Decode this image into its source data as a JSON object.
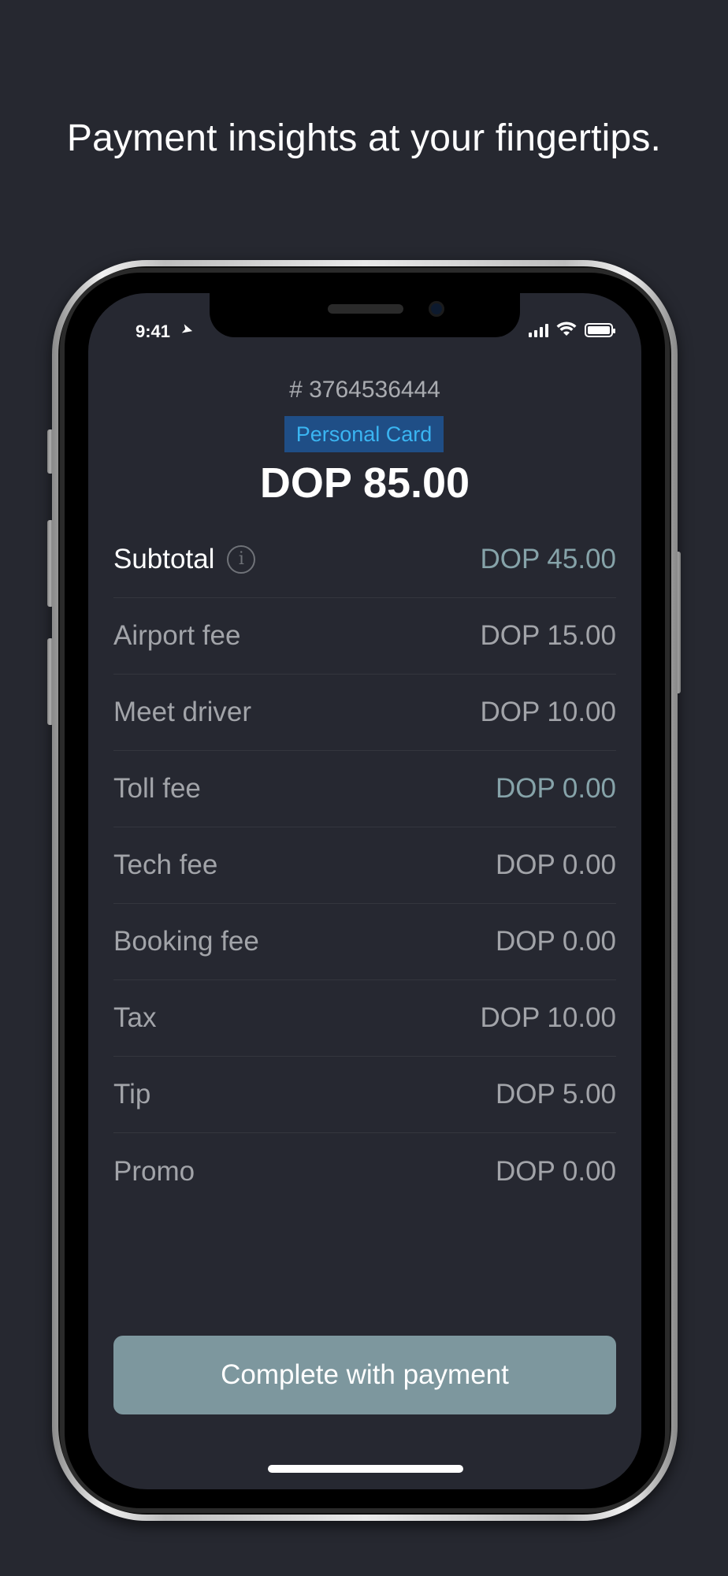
{
  "headline": "Payment insights at your fingertips.",
  "status_bar": {
    "time": "9:41"
  },
  "order": {
    "number": "# 3764536444",
    "card_type": "Personal Card",
    "total": "DOP 85.00"
  },
  "breakdown": [
    {
      "label": "Subtotal",
      "value": "DOP 45.00"
    },
    {
      "label": "Airport fee",
      "value": "DOP 15.00"
    },
    {
      "label": "Meet driver",
      "value": "DOP 10.00"
    },
    {
      "label": "Toll fee",
      "value": "DOP 0.00"
    },
    {
      "label": "Tech fee",
      "value": "DOP 0.00"
    },
    {
      "label": "Booking fee",
      "value": "DOP 0.00"
    },
    {
      "label": "Tax",
      "value": "DOP 10.00"
    },
    {
      "label": "Tip",
      "value": "DOP 5.00"
    },
    {
      "label": "Promo",
      "value": "DOP 0.00"
    }
  ],
  "subtotal_info_icon": "info-icon",
  "action": {
    "pay_label": "Complete with payment"
  },
  "colors": {
    "background": "#262830",
    "badge_bg": "#1f4e86",
    "badge_text": "#3ab5f2",
    "accent_value": "#86a3a9",
    "button": "#7d979e"
  }
}
